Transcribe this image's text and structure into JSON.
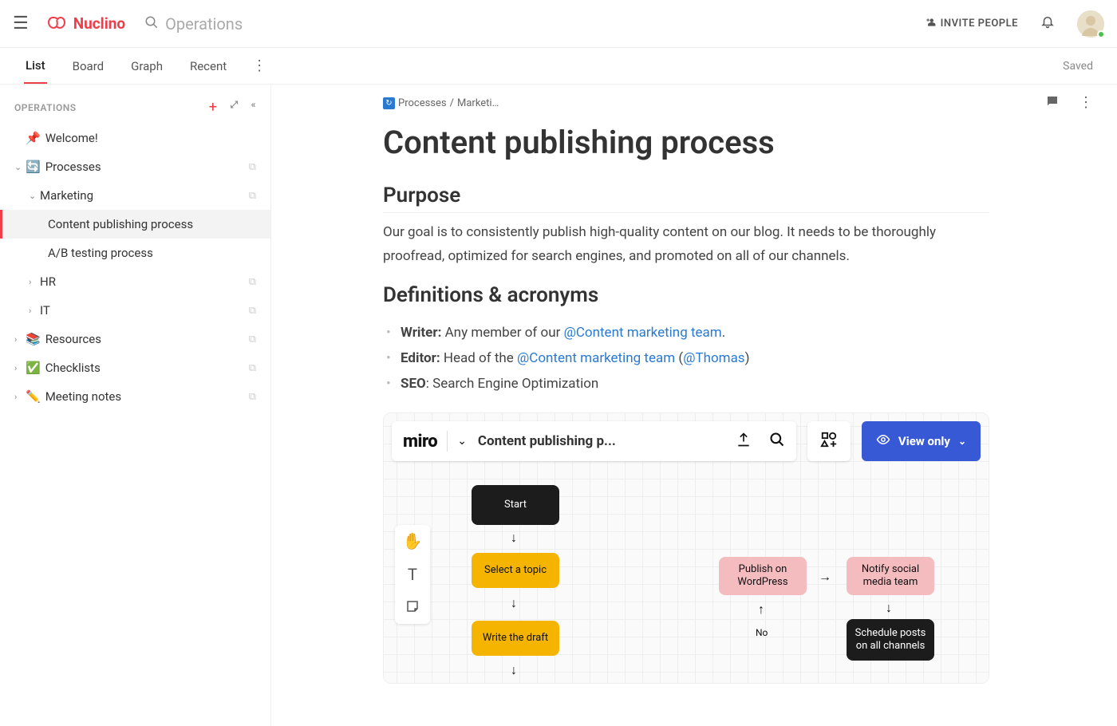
{
  "topbar": {
    "brand": "Nuclino",
    "search_placeholder": "Operations",
    "invite_label": "INVITE PEOPLE"
  },
  "viewbar": {
    "tabs": [
      "List",
      "Board",
      "Graph",
      "Recent"
    ],
    "active": 0,
    "saved_label": "Saved"
  },
  "sidebar": {
    "section_label": "OPERATIONS",
    "items": [
      {
        "chevron": "",
        "emoji": "📌",
        "label": "Welcome!",
        "level": 1,
        "copy": false
      },
      {
        "chevron": "⌄",
        "emoji": "🔄",
        "label": "Processes",
        "level": 1,
        "copy": true
      },
      {
        "chevron": "⌄",
        "emoji": "",
        "label": "Marketing",
        "level": 2,
        "copy": true
      },
      {
        "chevron": "",
        "emoji": "",
        "label": "Content publishing process",
        "level": 3,
        "copy": false,
        "selected": true
      },
      {
        "chevron": "",
        "emoji": "",
        "label": "A/B testing process",
        "level": 3,
        "copy": false
      },
      {
        "chevron": "›",
        "emoji": "",
        "label": "HR",
        "level": 2,
        "copy": true
      },
      {
        "chevron": "›",
        "emoji": "",
        "label": "IT",
        "level": 2,
        "copy": true
      },
      {
        "chevron": "›",
        "emoji": "📚",
        "label": "Resources",
        "level": 1,
        "copy": true
      },
      {
        "chevron": "›",
        "emoji": "✅",
        "label": "Checklists",
        "level": 1,
        "copy": true
      },
      {
        "chevron": "›",
        "emoji": "✏️",
        "label": "Meeting notes",
        "level": 1,
        "copy": true
      }
    ]
  },
  "breadcrumb": {
    "path1": "Processes",
    "path2": "Marketi…"
  },
  "page": {
    "title": "Content publishing process",
    "h_purpose": "Purpose",
    "purpose_body": "Our goal is to consistently publish high-quality content on our blog. It needs to be thoroughly proofread, optimized for search engines, and promoted on all of our channels.",
    "h_defs": "Definitions & acronyms",
    "def1_b": "Writer:",
    "def1_t": " Any member of our ",
    "def1_m": "@Content marketing team",
    "def1_e": ".",
    "def2_b": "Editor:",
    "def2_t": " Head of the ",
    "def2_m1": "@Content marketing team",
    "def2_mid": " (",
    "def2_m2": "@Thomas",
    "def2_e": ")",
    "def3_b": "SEO",
    "def3_t": ": Search Engine Optimization"
  },
  "miro": {
    "logo": "miro",
    "title": "Content publishing p...",
    "view_only": "View only",
    "nodes": {
      "start": "Start",
      "select": "Select a topic",
      "write": "Write the draft",
      "publish": "Publish on WordPress",
      "notify": "Notify social media team",
      "schedule": "Schedule posts on all channels",
      "no": "No"
    }
  }
}
